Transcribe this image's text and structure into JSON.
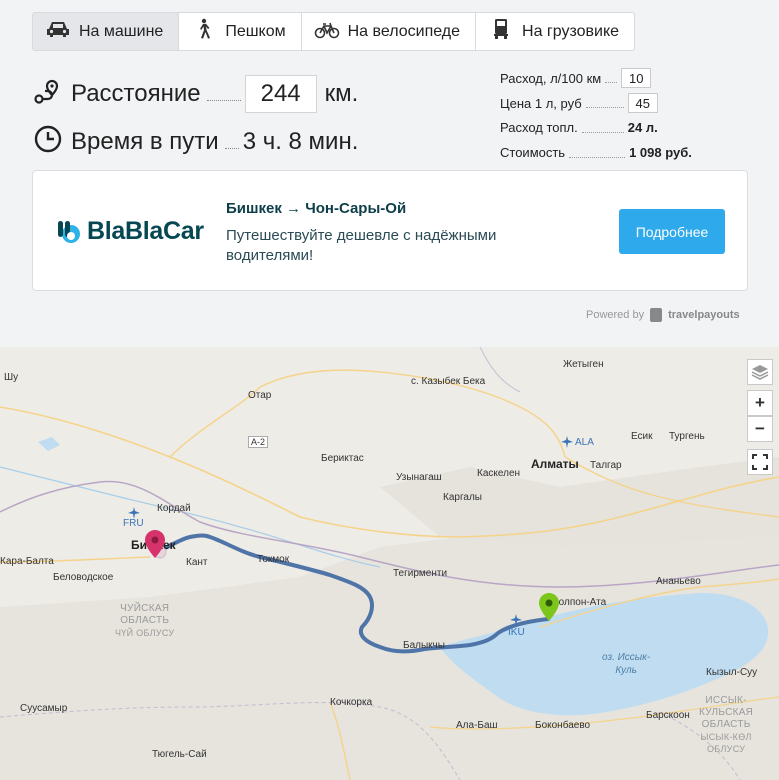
{
  "tabs": [
    {
      "label": "На машине",
      "icon": "car-icon"
    },
    {
      "label": "Пешком",
      "icon": "walk-icon"
    },
    {
      "label": "На велосипеде",
      "icon": "bicycle-icon"
    },
    {
      "label": "На грузовике",
      "icon": "truck-icon"
    }
  ],
  "summary": {
    "distance_label": "Расстояние",
    "distance_value": "244",
    "distance_unit": "км.",
    "time_label": "Время в пути",
    "time_value": "3 ч. 8 мин."
  },
  "fuel": {
    "consumption_label": "Расход, л/100 км",
    "consumption_value": "10",
    "price_label": "Цена 1 л, руб",
    "price_value": "45",
    "fuel_label": "Расход топл.",
    "fuel_value": "24 л.",
    "cost_label": "Стоимость",
    "cost_value": "1 098 руб."
  },
  "banner": {
    "logo": "BlaBlaCar",
    "title": "Бишкек → Чон-Сары-Ой",
    "subtitle": "Путешествуйте дешевле с надёжными водителями!",
    "button": "Подробнее",
    "powered_by": "Powered by",
    "powered_brand": "travelpayouts"
  },
  "map": {
    "places": {
      "shu": "Шу",
      "zhetygen": "Жетыген",
      "kazybek": "с. Казыбек Бека",
      "otar": "Отар",
      "a2": "A-2",
      "ala": "ALA",
      "esik": "Есик",
      "turgen": "Тургень",
      "beriktas": "Бериктас",
      "almaty": "Алматы",
      "talgar": "Талгар",
      "uzynagash": "Узынагаш",
      "kaskelen": "Каскелен",
      "kargaly": "Каргалы",
      "korday": "Кордай",
      "fru": "FRU",
      "bishkek": "Бишкек",
      "kant": "Кант",
      "tokmok": "Токмок",
      "karabalta": "Кара-Балта",
      "belovodskoe": "Беловодское",
      "tegirmenti": "Тегирменти",
      "ananyevo": "Ананьево",
      "cholponata": "Чолпон-Ата",
      "iku": "IKU",
      "balykchy": "Балыкчы",
      "chuy1": "ЧУЙСКАЯ",
      "chuy2": "ОБЛАСТЬ",
      "chuy3": "ЧҮЙ ОБЛУСУ",
      "lake1": "оз. Иссык-",
      "lake2": "Куль",
      "kyzylsuu": "Кызыл-Суу",
      "suusamyr": "Суусамыр",
      "kochkorka": "Кочкорка",
      "barskoon": "Барскоон",
      "ik1": "ИССЫК-",
      "ik2": "КУЛЬСКАЯ",
      "ik3": "ОБЛАСТЬ",
      "ik4": "ЫСЫК-КӨЛ",
      "ik5": "ОБЛУСУ",
      "alabash": "Ала-Баш",
      "bokonbaevo": "Боконбаево",
      "tugelsai": "Тюгель-Сай"
    },
    "controls": {
      "zoom_in": "+",
      "zoom_out": "−"
    }
  },
  "colors": {
    "route": "#4f74a8",
    "start_marker": "#d6336c",
    "end_marker": "#7cc61c",
    "button": "#2da9ec",
    "lake": "#bfdcf1"
  }
}
